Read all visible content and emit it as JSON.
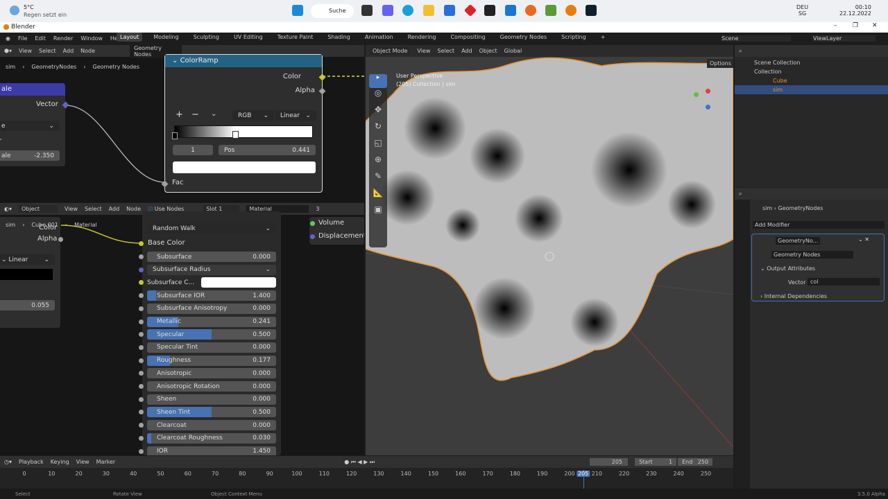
{
  "taskbar": {
    "weather_temp": "5°C",
    "weather_text": "Regen setzt ein",
    "search_label": "Suche",
    "lang": "DEU",
    "lang_sub": "SG",
    "time": "00:10",
    "date": "22.12.2022"
  },
  "window": {
    "title": "Blender"
  },
  "topbar": {
    "menus": [
      "File",
      "Edit",
      "Render",
      "Window",
      "Help"
    ],
    "workspaces": [
      "Layout",
      "Modeling",
      "Sculpting",
      "UV Editing",
      "Texture Paint",
      "Shading",
      "Animation",
      "Rendering",
      "Compositing",
      "Geometry Nodes",
      "Scripting",
      "+"
    ],
    "scene": "Scene",
    "view_layer": "ViewLayer"
  },
  "geo_editor": {
    "menus": [
      "View",
      "Select",
      "Add",
      "Node"
    ],
    "tree_name": "Geometry Nodes",
    "breadcrumb": [
      "sim",
      "GeometryNodes",
      "Geometry Nodes"
    ],
    "left_node": {
      "title": "ale",
      "output": "Vector",
      "dropdown": "e",
      "row": "r",
      "field_label": "ale",
      "field_value": "-2.350"
    },
    "colorramp": {
      "title": "ColorRamp",
      "out_color": "Color",
      "out_alpha": "Alpha",
      "add": "+",
      "remove": "−",
      "color_mode": "RGB",
      "interpolation": "Linear",
      "stop_index": "1",
      "pos_label": "Pos",
      "pos_value": "0.441",
      "stop_position": 0.441,
      "input": "Fac"
    }
  },
  "shader_editor": {
    "object_mode": "Object",
    "menus": [
      "View",
      "Select",
      "Add",
      "Node"
    ],
    "use_nodes": "Use Nodes",
    "slot": "Slot 1",
    "material": "Material",
    "users": "3",
    "breadcrumb": [
      "sim",
      "Cube.001",
      "Material"
    ],
    "left_node": {
      "out_color": "Color",
      "out_alpha": "Alpha",
      "interp": "Linear",
      "value": "0.055"
    },
    "bsdf": {
      "subsurface_method": "Random Walk",
      "base_color": "Base Color",
      "inputs": [
        {
          "label": "Subsurface",
          "value": "0.000",
          "fill": 0
        },
        {
          "label": "Subsurface Radius",
          "value": "",
          "fill": 0,
          "dropdown": true
        },
        {
          "label": "Subsurface C...",
          "value": "",
          "fill": 0,
          "color": true
        },
        {
          "label": "Subsurface IOR",
          "value": "1.400",
          "fill": 0.07
        },
        {
          "label": "Subsurface Anisotropy",
          "value": "0.000",
          "fill": 0
        },
        {
          "label": "Metallic",
          "value": "0.241",
          "fill": 0.241
        },
        {
          "label": "Specular",
          "value": "0.500",
          "fill": 0.5
        },
        {
          "label": "Specular Tint",
          "value": "0.000",
          "fill": 0
        },
        {
          "label": "Roughness",
          "value": "0.177",
          "fill": 0.177
        },
        {
          "label": "Anisotropic",
          "value": "0.000",
          "fill": 0
        },
        {
          "label": "Anisotropic Rotation",
          "value": "0.000",
          "fill": 0
        },
        {
          "label": "Sheen",
          "value": "0.000",
          "fill": 0
        },
        {
          "label": "Sheen Tint",
          "value": "0.500",
          "fill": 0.5
        },
        {
          "label": "Clearcoat",
          "value": "0.000",
          "fill": 0
        },
        {
          "label": "Clearcoat Roughness",
          "value": "0.030",
          "fill": 0.03
        },
        {
          "label": "IOR",
          "value": "1.450",
          "fill": 0
        }
      ]
    },
    "output_node": {
      "volume": "Volume",
      "displacement": "Displacement"
    }
  },
  "viewport": {
    "mode": "Object Mode",
    "menus": [
      "View",
      "Select",
      "Add",
      "Object"
    ],
    "orientation": "Global",
    "options": "Options",
    "perspective": "User Perspective",
    "collection_info": "(205) Collection | sim"
  },
  "outliner": {
    "items": [
      {
        "label": "Scene Collection"
      },
      {
        "label": "Collection"
      },
      {
        "label": "Cube"
      },
      {
        "label": "sim"
      }
    ]
  },
  "properties": {
    "breadcrumb": [
      "sim",
      "GeometryNodes"
    ],
    "add_modifier": "Add Modifier",
    "modifier_name": "GeometryNo...",
    "node_group": "Geometry Nodes",
    "output_attributes": "Output Attributes",
    "vector_label": "Vector",
    "vector_value": "col",
    "internal_deps": "Internal Dependencies"
  },
  "timeline": {
    "menus": [
      "Playback",
      "Keying",
      "View",
      "Marker"
    ],
    "current_frame": "205",
    "start_label": "Start",
    "start": "1",
    "end_label": "End",
    "end": "250",
    "ticks": [
      "0",
      "10",
      "20",
      "30",
      "40",
      "50",
      "60",
      "70",
      "80",
      "90",
      "100",
      "110",
      "120",
      "130",
      "140",
      "150",
      "160",
      "170",
      "180",
      "190",
      "200",
      "210",
      "220",
      "230",
      "240",
      "250"
    ],
    "playhead": 205
  },
  "statusbar": {
    "select": "Select",
    "rotate": "Rotate View",
    "context": "Object Context Menu",
    "version": "3.5.0 Alpha"
  },
  "colors": {
    "accent": "#4772b3",
    "selection": "#f5a623",
    "node_header": "#246283"
  }
}
